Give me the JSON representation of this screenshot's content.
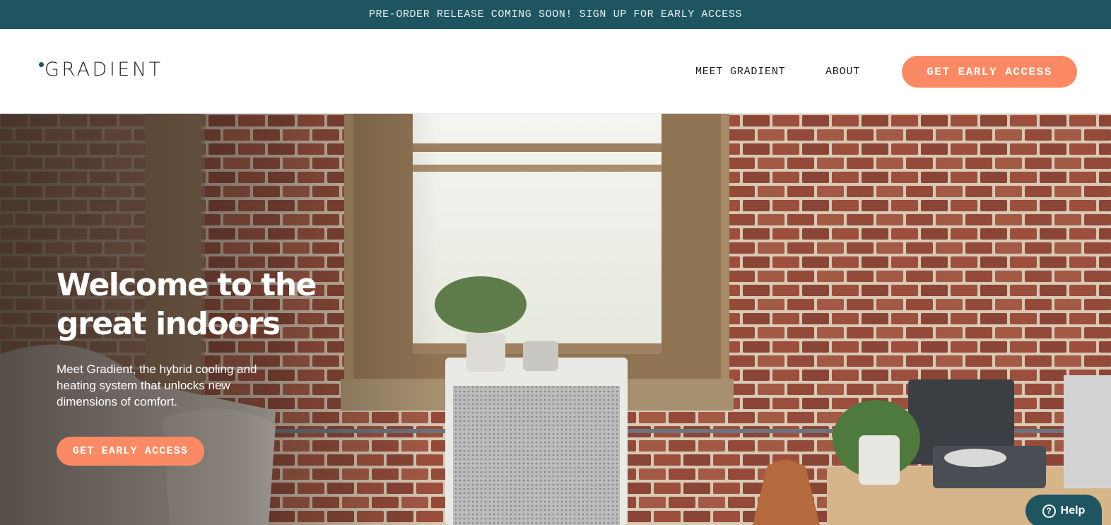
{
  "announcement": {
    "text": "PRE-ORDER RELEASE COMING SOON! SIGN UP FOR EARLY ACCESS"
  },
  "header": {
    "logo_text": "GRADIENT",
    "nav": [
      {
        "label": "MEET GRADIENT"
      },
      {
        "label": "ABOUT"
      }
    ],
    "cta_label": "GET EARLY ACCESS"
  },
  "hero": {
    "title": "Welcome to the great indoors",
    "subtitle": "Meet Gradient, the hybrid cooling and heating system that unlocks new dimensions of comfort.",
    "cta_label": "GET EARLY ACCESS"
  },
  "help": {
    "label": "Help",
    "icon": "question-circle-icon"
  },
  "colors": {
    "brand_teal": "#1e5560",
    "accent_coral": "#fb8a64",
    "brick": "#8f4d3b"
  }
}
